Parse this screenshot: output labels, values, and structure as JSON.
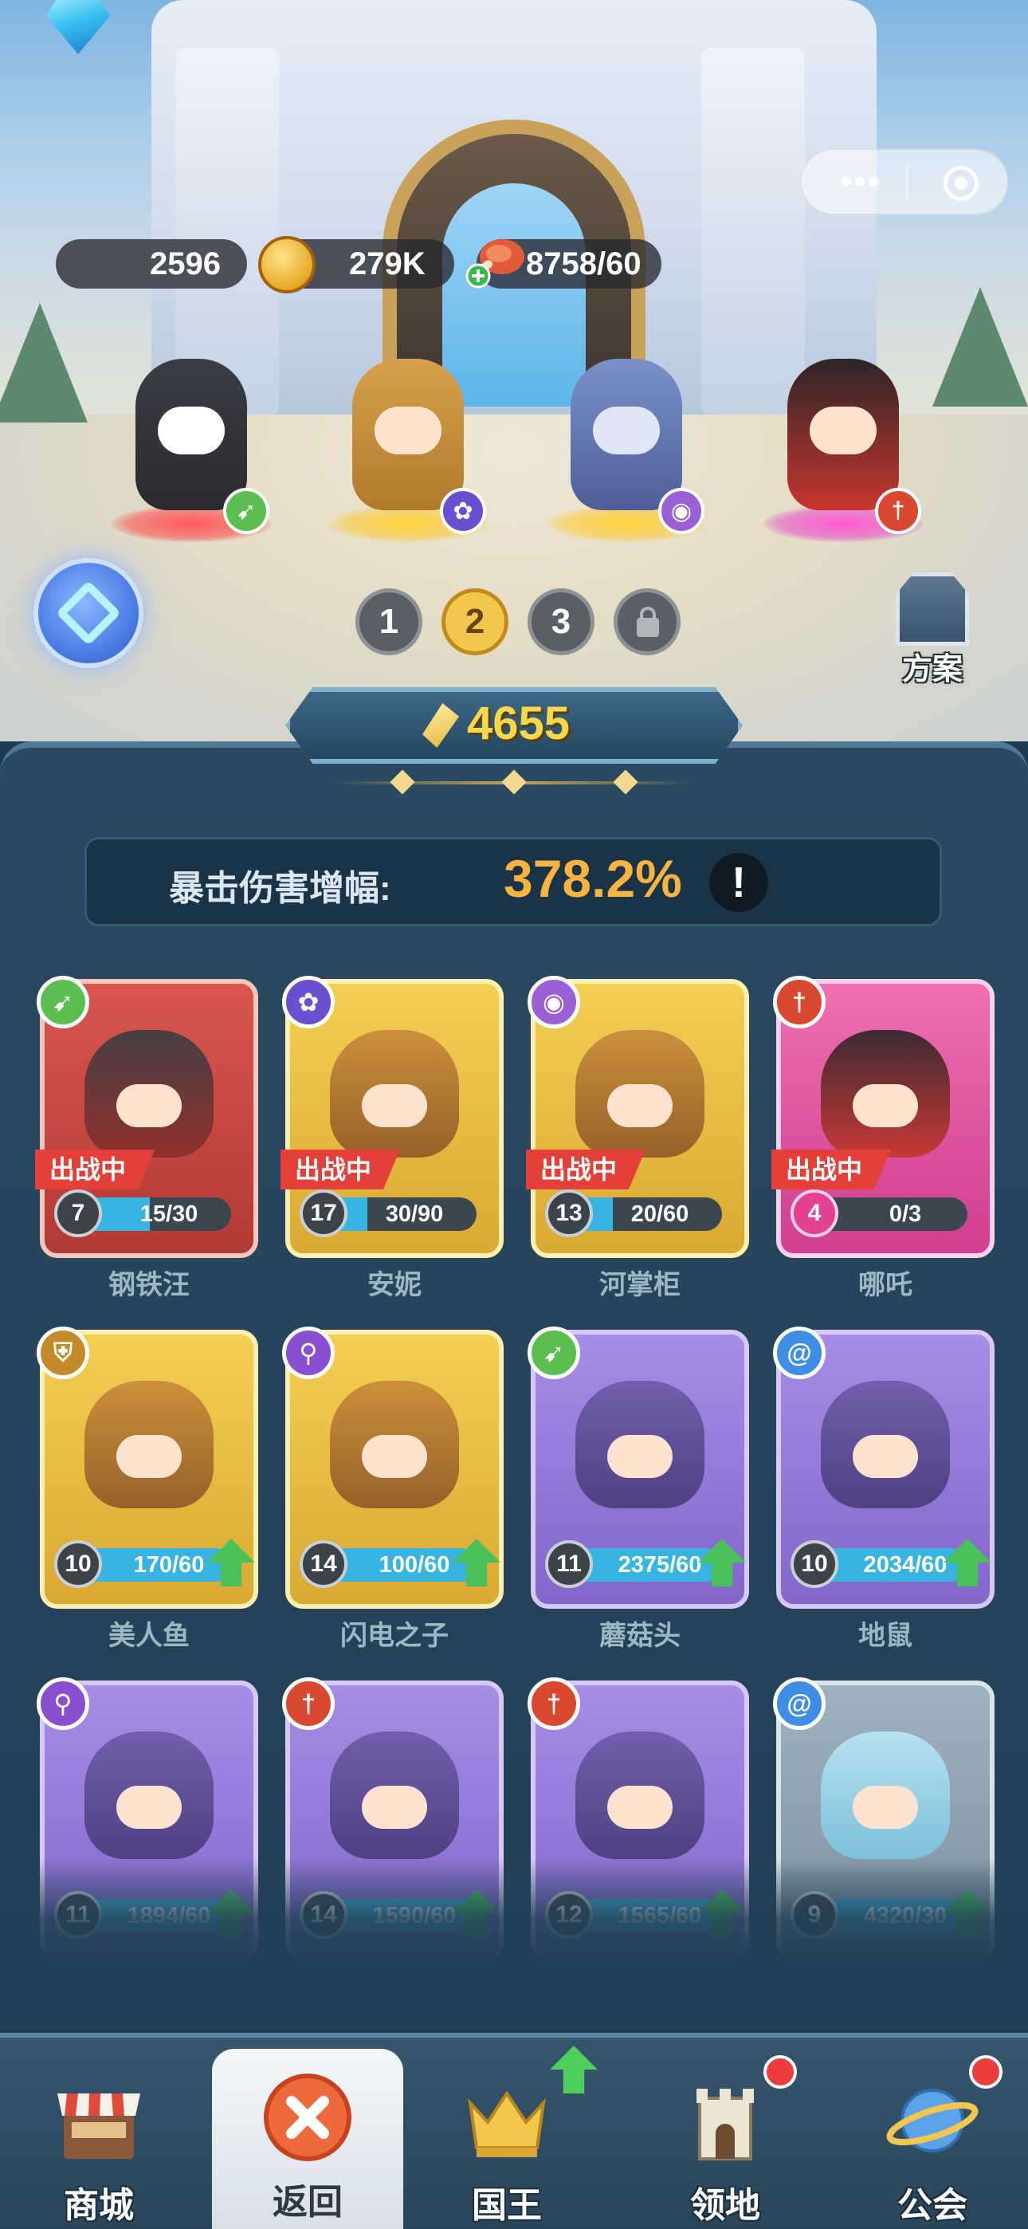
{
  "resources": {
    "gems": "2596",
    "coins": "279K",
    "stamina": "8758/60"
  },
  "team": {
    "slots": [
      "1",
      "2",
      "3"
    ],
    "active_slot": "2",
    "plan_label": "方案"
  },
  "power": "4655",
  "stat": {
    "label": "暴击伤害增幅:",
    "value": "378.2%",
    "info": "!"
  },
  "status_deployed": "出战中",
  "heroes": [
    {
      "name": "钢铁汪",
      "level": "7",
      "progress": "15/30",
      "fraction": 0.5,
      "deployed": true,
      "rarity": "red",
      "class_icon": "bow-icon",
      "class_color": "#5bbf4f"
    },
    {
      "name": "安妮",
      "level": "17",
      "progress": "30/90",
      "fraction": 0.33,
      "deployed": true,
      "rarity": "gold",
      "class_icon": "paw-icon",
      "class_color": "#6a4fd0"
    },
    {
      "name": "河掌柜",
      "level": "13",
      "progress": "20/60",
      "fraction": 0.33,
      "deployed": true,
      "rarity": "gold",
      "class_icon": "eye-icon",
      "class_color": "#9b5fd6"
    },
    {
      "name": "哪吒",
      "level": "4",
      "progress": "0/3",
      "fraction": 0.0,
      "deployed": true,
      "rarity": "pink",
      "class_icon": "sword-icon",
      "class_color": "#d9482f"
    },
    {
      "name": "美人鱼",
      "level": "10",
      "progress": "170/60",
      "fraction": 1.0,
      "deployed": false,
      "rarity": "gold",
      "class_icon": "shield-icon",
      "class_color": "#c48a2a"
    },
    {
      "name": "闪电之子",
      "level": "14",
      "progress": "100/60",
      "fraction": 1.0,
      "deployed": false,
      "rarity": "gold",
      "class_icon": "staff-icon",
      "class_color": "#8a4fd0"
    },
    {
      "name": "蘑菇头",
      "level": "11",
      "progress": "2375/60",
      "fraction": 1.0,
      "deployed": false,
      "rarity": "purple",
      "class_icon": "bow-icon",
      "class_color": "#5bbf4f"
    },
    {
      "name": "地鼠",
      "level": "10",
      "progress": "2034/60",
      "fraction": 1.0,
      "deployed": false,
      "rarity": "purple",
      "class_icon": "spiral-icon",
      "class_color": "#3f8ee6"
    },
    {
      "name": "",
      "level": "11",
      "progress": "1894/60",
      "fraction": 1.0,
      "deployed": false,
      "rarity": "purple",
      "class_icon": "staff-icon",
      "class_color": "#8a4fd0"
    },
    {
      "name": "",
      "level": "14",
      "progress": "1590/60",
      "fraction": 1.0,
      "deployed": false,
      "rarity": "purple",
      "class_icon": "sword-icon",
      "class_color": "#d9482f"
    },
    {
      "name": "",
      "level": "12",
      "progress": "1565/60",
      "fraction": 1.0,
      "deployed": false,
      "rarity": "purple",
      "class_icon": "sword-icon",
      "class_color": "#d9482f"
    },
    {
      "name": "",
      "level": "9",
      "progress": "4320/30",
      "fraction": 1.0,
      "deployed": false,
      "rarity": "grey",
      "class_icon": "spiral-icon",
      "class_color": "#3f8ee6"
    }
  ],
  "nav": {
    "shop": "商城",
    "back": "返回",
    "king": "国王",
    "territory": "领地",
    "guild": "公会"
  }
}
